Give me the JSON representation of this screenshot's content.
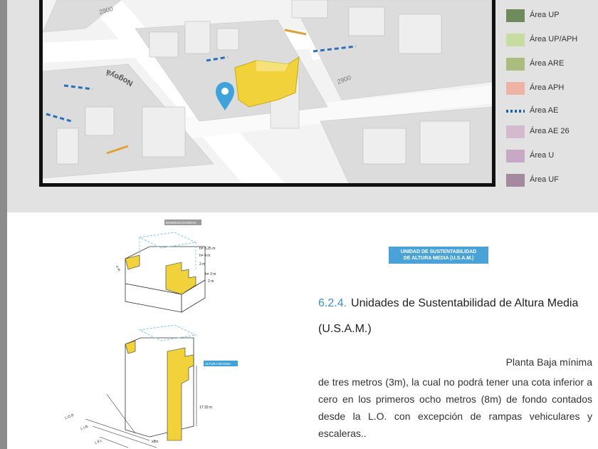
{
  "map": {
    "street_north": "2900",
    "street_center": "2900",
    "street_name": "Nogoyá"
  },
  "legend": {
    "items": [
      {
        "label": "Área UP",
        "color": "#6f8a5b",
        "style": "swatch"
      },
      {
        "label": "Área UP/APH",
        "color": "#c7dca1",
        "style": "swatch"
      },
      {
        "label": "Área ARE",
        "color": "#a8bd7e",
        "style": "swatch"
      },
      {
        "label": "Área APH",
        "color": "#efb3a6",
        "style": "swatch"
      },
      {
        "label": "Área AE",
        "color": "#1d5fa8",
        "style": "dots"
      },
      {
        "label": "Área AE 26",
        "color": "#d5b9cf",
        "style": "swatch"
      },
      {
        "label": "Área U",
        "color": "#c8a9c5",
        "style": "swatch"
      },
      {
        "label": "Área UF",
        "color": "#a58a9f",
        "style": "swatch"
      }
    ]
  },
  "diagram_top": {
    "label": "BOMBENCOORDOS",
    "dims": [
      "h= 3,25 m",
      "h= 4 m",
      "2 m",
      "h= 3 m",
      "2 m"
    ],
    "side_dim": "4 m"
  },
  "diagram_bottom": {
    "label": "ALTURA MÁXIMA",
    "height": "17.20  m",
    "lines": [
      "L.O.P.",
      "L.I.B.",
      "L.F.I."
    ],
    "depth": "x8m"
  },
  "tag": {
    "line1": "UNIDAD DE SUSTENTABILIDAD",
    "line2": "DE ALTURA MEDIA (U.S.A.M.)"
  },
  "section": {
    "number": "6.2.4.",
    "title": "Unidades de Sustentabilidad de Altura Media (U.S.A.M.)",
    "lead": "Planta Baja mínima",
    "body": "de tres metros (3m), la cual no podrá tener una cota inferior a cero en los primeros ocho metros (8m) de fondo contados desde la L.O. con excepción de rampas vehiculares y escaleras.."
  }
}
